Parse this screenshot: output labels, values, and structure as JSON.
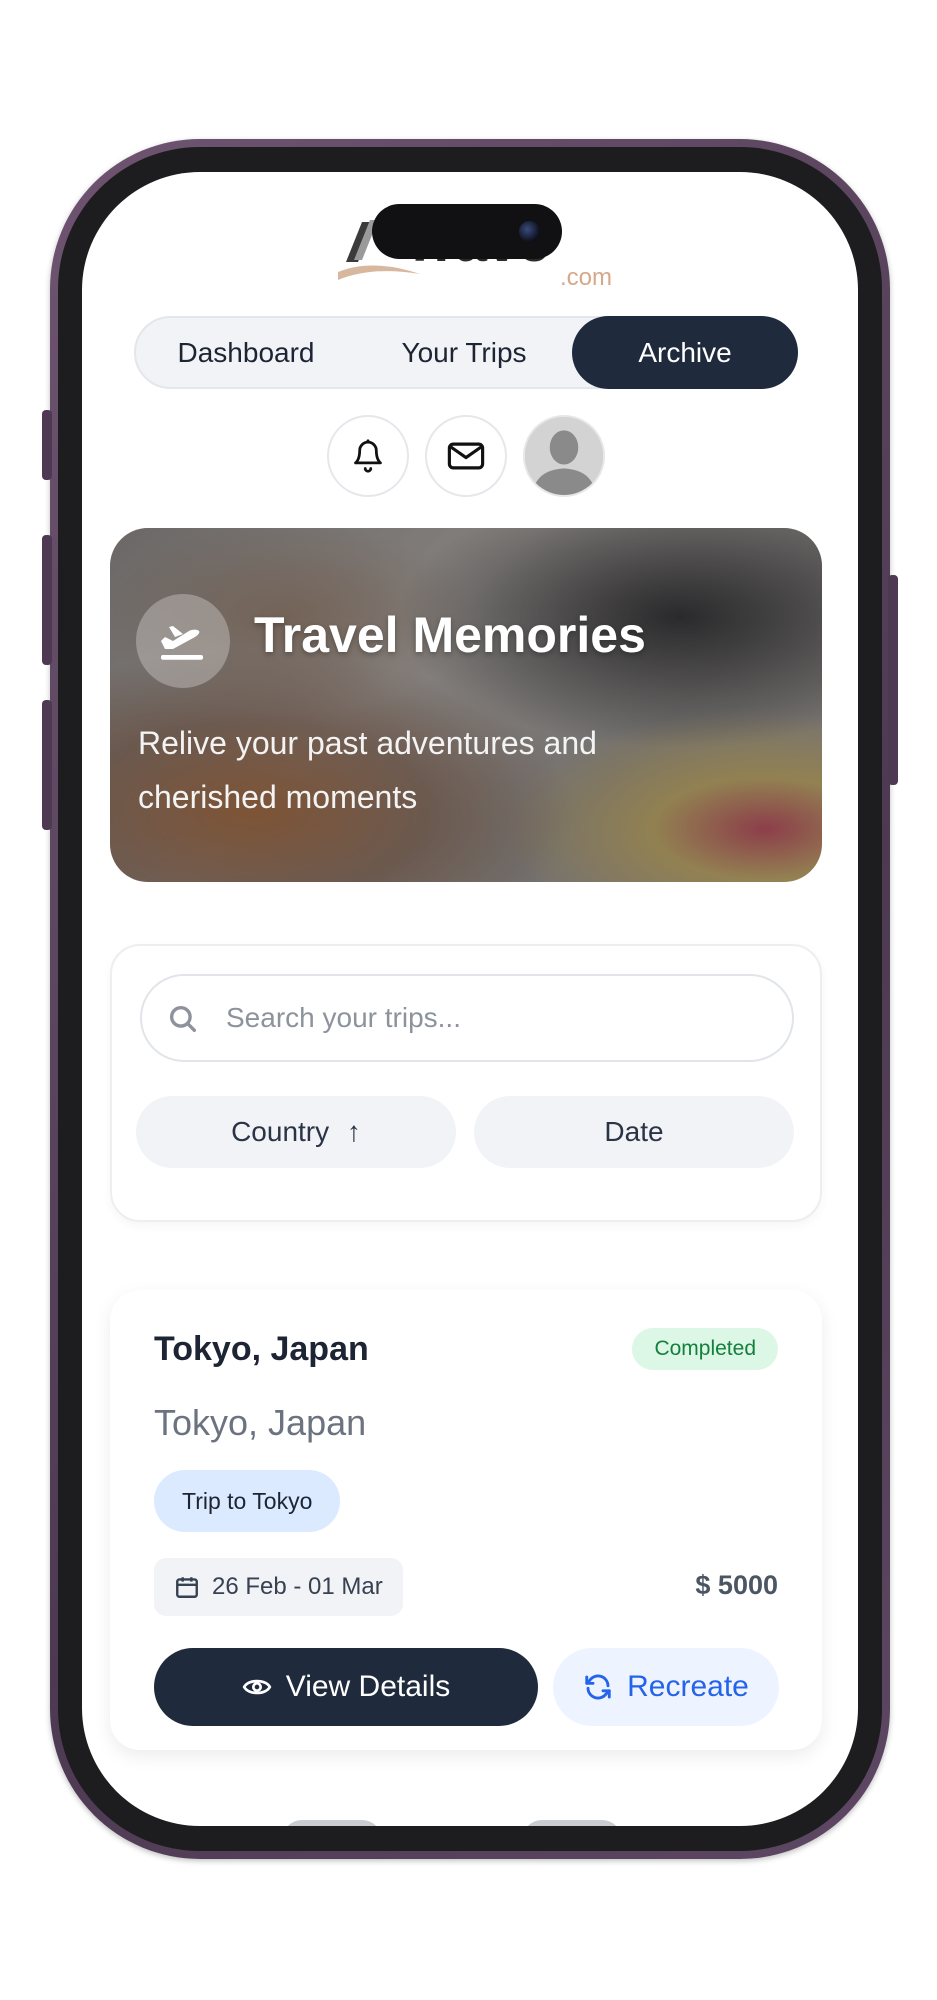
{
  "logo": {
    "name": "Trave",
    "suffix": ".com"
  },
  "nav": {
    "items": [
      {
        "label": "Dashboard"
      },
      {
        "label": "Your Trips"
      },
      {
        "label": "Archive"
      }
    ],
    "active": "Archive"
  },
  "icons": {
    "notifications": "bell-icon",
    "messages": "mail-icon",
    "profile": "avatar"
  },
  "hero": {
    "title": "Travel Memories",
    "subtitle": "Relive your past adventures and cherished moments",
    "icon": "plane-departure-icon"
  },
  "filters": {
    "search_placeholder": "Search your trips...",
    "sort_country_label": "Country",
    "sort_country_arrow": "↑",
    "sort_date_label": "Date"
  },
  "trips": [
    {
      "title": "Tokyo, Japan",
      "status": "Completed",
      "location": "Tokyo, Japan",
      "tag": "Trip to Tokyo",
      "dates": "26 Feb - 01 Mar",
      "price": "$ 5000",
      "view_label": "View Details",
      "recreate_label": "Recreate"
    }
  ],
  "colors": {
    "primary_dark": "#1f2a3d",
    "accent_blue": "#2563eb",
    "status_green": "#15803d",
    "phone_frame": "#5d4763"
  }
}
